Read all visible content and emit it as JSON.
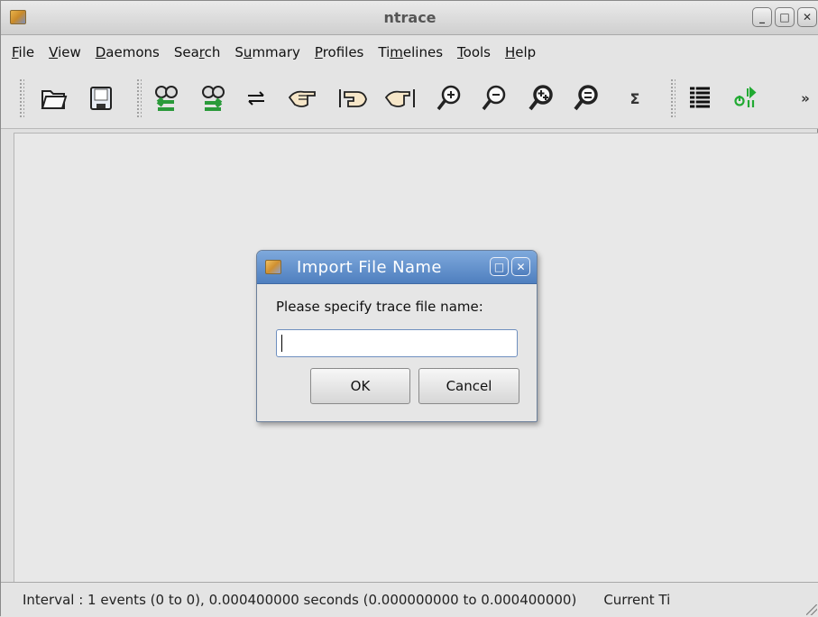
{
  "window": {
    "title": "ntrace",
    "controls": [
      "minimize",
      "maximize",
      "close"
    ]
  },
  "menubar": {
    "items": [
      {
        "pre": "",
        "u": "F",
        "post": "ile"
      },
      {
        "pre": "",
        "u": "V",
        "post": "iew"
      },
      {
        "pre": "",
        "u": "D",
        "post": "aemons"
      },
      {
        "pre": "Sea",
        "u": "r",
        "post": "ch"
      },
      {
        "pre": "S",
        "u": "u",
        "post": "mmary"
      },
      {
        "pre": "",
        "u": "P",
        "post": "rofiles"
      },
      {
        "pre": "Ti",
        "u": "m",
        "post": "elines"
      },
      {
        "pre": "",
        "u": "T",
        "post": "ools"
      },
      {
        "pre": "",
        "u": "H",
        "post": "elp"
      }
    ]
  },
  "toolbar": {
    "icons": [
      "open-folder-icon",
      "save-icon",
      "daemon-left-icon",
      "daemon-right-icon",
      "swap-arrows-icon",
      "hand-point-left-icon",
      "hand-point-start-icon",
      "hand-point-end-icon",
      "zoom-in-icon",
      "zoom-out-icon",
      "zoom-in-more-icon",
      "zoom-out-more-icon",
      "sigma-icon",
      "list-icon",
      "start-stop-icon",
      "overflow-chevron-icon"
    ],
    "sigma_glyph": "Σ",
    "overflow_glyph": "»"
  },
  "dialog": {
    "title": "Import File Name",
    "prompt": "Please specify trace file name:",
    "input_value": "",
    "ok_label": "OK",
    "cancel_label": "Cancel"
  },
  "statusbar": {
    "interval_text": "Interval : 1 events (0 to 0), 0.000400000 seconds (0.000000000 to 0.000400000)",
    "current_text": "Current Ti"
  },
  "colors": {
    "dialog_title_bg": "#5b8bc8",
    "window_bg": "#e0e0e0"
  }
}
